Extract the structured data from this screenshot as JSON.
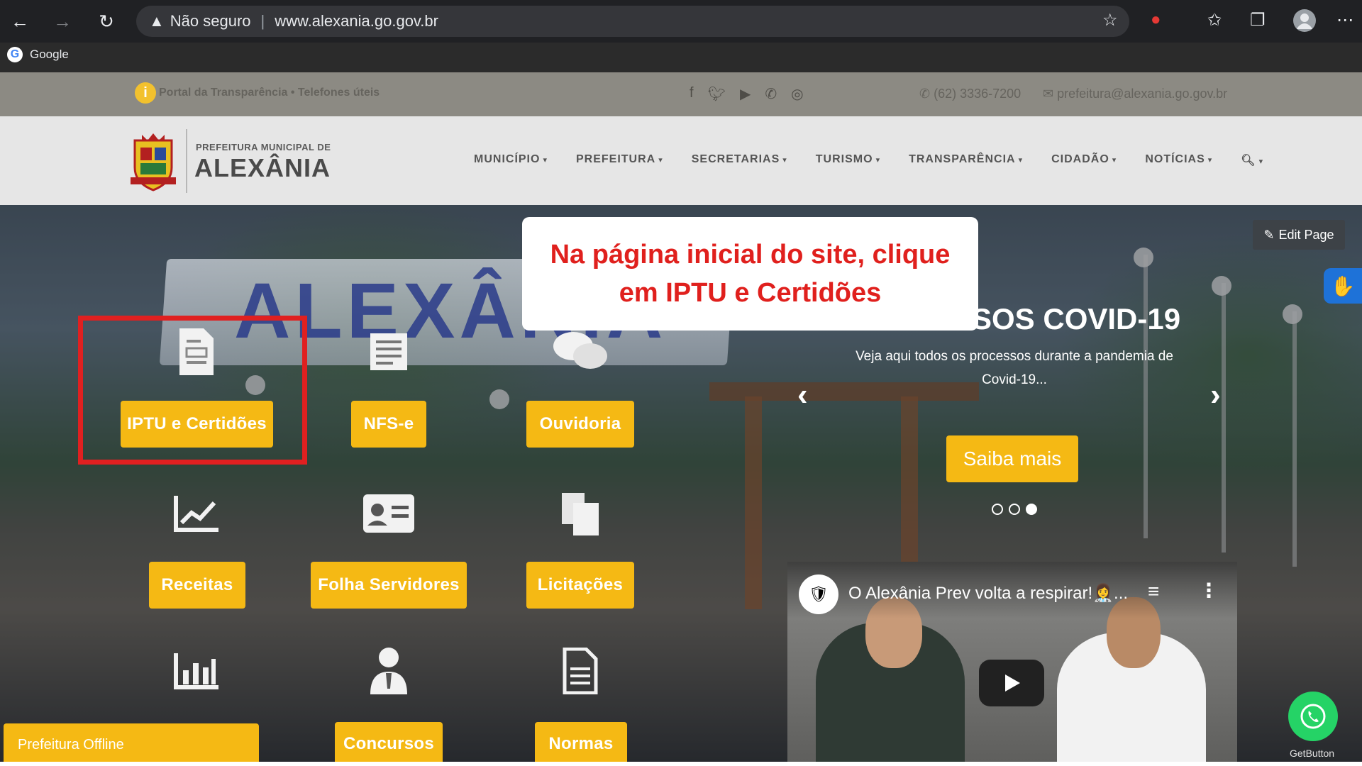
{
  "browser": {
    "security_label": "Não seguro",
    "url": "www.alexania.go.gov.br",
    "bookmark_label": "Google"
  },
  "topbar": {
    "info_text": "Portal da Transparência • Telefones úteis",
    "phone": "(62) 3336-7200",
    "email": "prefeitura@alexania.go.gov.br"
  },
  "header": {
    "logo_subtitle": "PREFEITURA MUNICIPAL DE",
    "logo_title": "ALEXÂNIA",
    "nav": [
      "MUNICÍPIO",
      "PREFEITURA",
      "SECRETARIAS",
      "TURISMO",
      "TRANSPARÊNCIA",
      "CIDADÃO",
      "NOTÍCIAS"
    ]
  },
  "tiles": {
    "iptu": "IPTU e Certidões",
    "nfse": "NFS-e",
    "ouvidoria": "Ouvidoria",
    "receitas": "Receitas",
    "folha": "Folha Servidores",
    "licitacoes": "Licitações",
    "concursos": "Concursos",
    "normas": "Normas"
  },
  "callout": {
    "text": "Na página inicial do site, clique em IPTU e Certidões"
  },
  "slider": {
    "title": "SOS COVID-19",
    "description": "Veja aqui todos os processos durante a pandemia de Covid-19...",
    "cta": "Saiba mais"
  },
  "edit_page": "Edit Page",
  "video": {
    "title": "O Alexânia Prev volta a respirar!👩‍⚕️..."
  },
  "offline_label": "Prefeitura Offline",
  "getbutton_label": "GetButton",
  "colors": {
    "accent_yellow": "#f5b914",
    "highlight_red": "#e02020",
    "callout_text": "#e0201d"
  }
}
